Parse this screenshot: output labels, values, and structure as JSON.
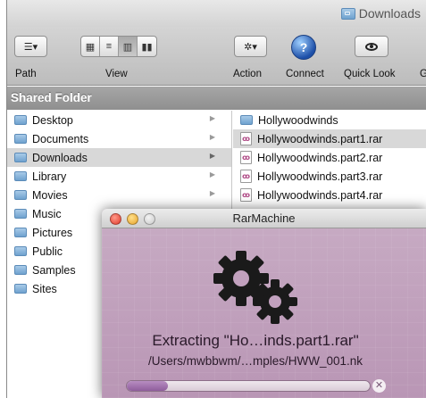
{
  "window": {
    "title": "Downloads"
  },
  "toolbar": {
    "path_label": "Path",
    "view_label": "View",
    "action_label": "Action",
    "connect_label": "Connect",
    "quicklook_label": "Quick Look",
    "cut_label": "Ge"
  },
  "sidebar": {
    "header": "Shared Folder",
    "items": [
      {
        "label": "Desktop",
        "icon": "folder-icon"
      },
      {
        "label": "Documents",
        "icon": "folder-icon"
      },
      {
        "label": "Downloads",
        "icon": "downloads-folder-icon",
        "selected": true
      },
      {
        "label": "Library",
        "icon": "library-folder-icon"
      },
      {
        "label": "Movies",
        "icon": "movies-folder-icon"
      },
      {
        "label": "Music",
        "icon": "music-folder-icon"
      },
      {
        "label": "Pictures",
        "icon": "pictures-folder-icon"
      },
      {
        "label": "Public",
        "icon": "public-folder-icon"
      },
      {
        "label": "Samples",
        "icon": "folder-icon"
      },
      {
        "label": "Sites",
        "icon": "sites-folder-icon"
      }
    ]
  },
  "files": [
    {
      "name": "Hollywoodwinds",
      "icon": "folder-icon"
    },
    {
      "name": "Hollywoodwinds.part1.rar",
      "icon": "rar-archive-icon",
      "selected": true
    },
    {
      "name": "Hollywoodwinds.part2.rar",
      "icon": "rar-archive-icon"
    },
    {
      "name": "Hollywoodwinds.part3.rar",
      "icon": "rar-archive-icon"
    },
    {
      "name": "Hollywoodwinds.part4.rar",
      "icon": "rar-archive-icon"
    }
  ],
  "rarmachine": {
    "title": "RarMachine",
    "status": "Extracting \"Ho…inds.part1.rar\"",
    "path": "/Users/mwbbwm/…mples/HWW_001.nk",
    "progress": 0.17,
    "cancel_glyph": "✕"
  },
  "colors": {
    "panel_bg": "#bf9fbb",
    "progress_fill": "#9b6aa8",
    "selection": "#d8d8d8",
    "folder_blue": "#6fa2cf"
  }
}
